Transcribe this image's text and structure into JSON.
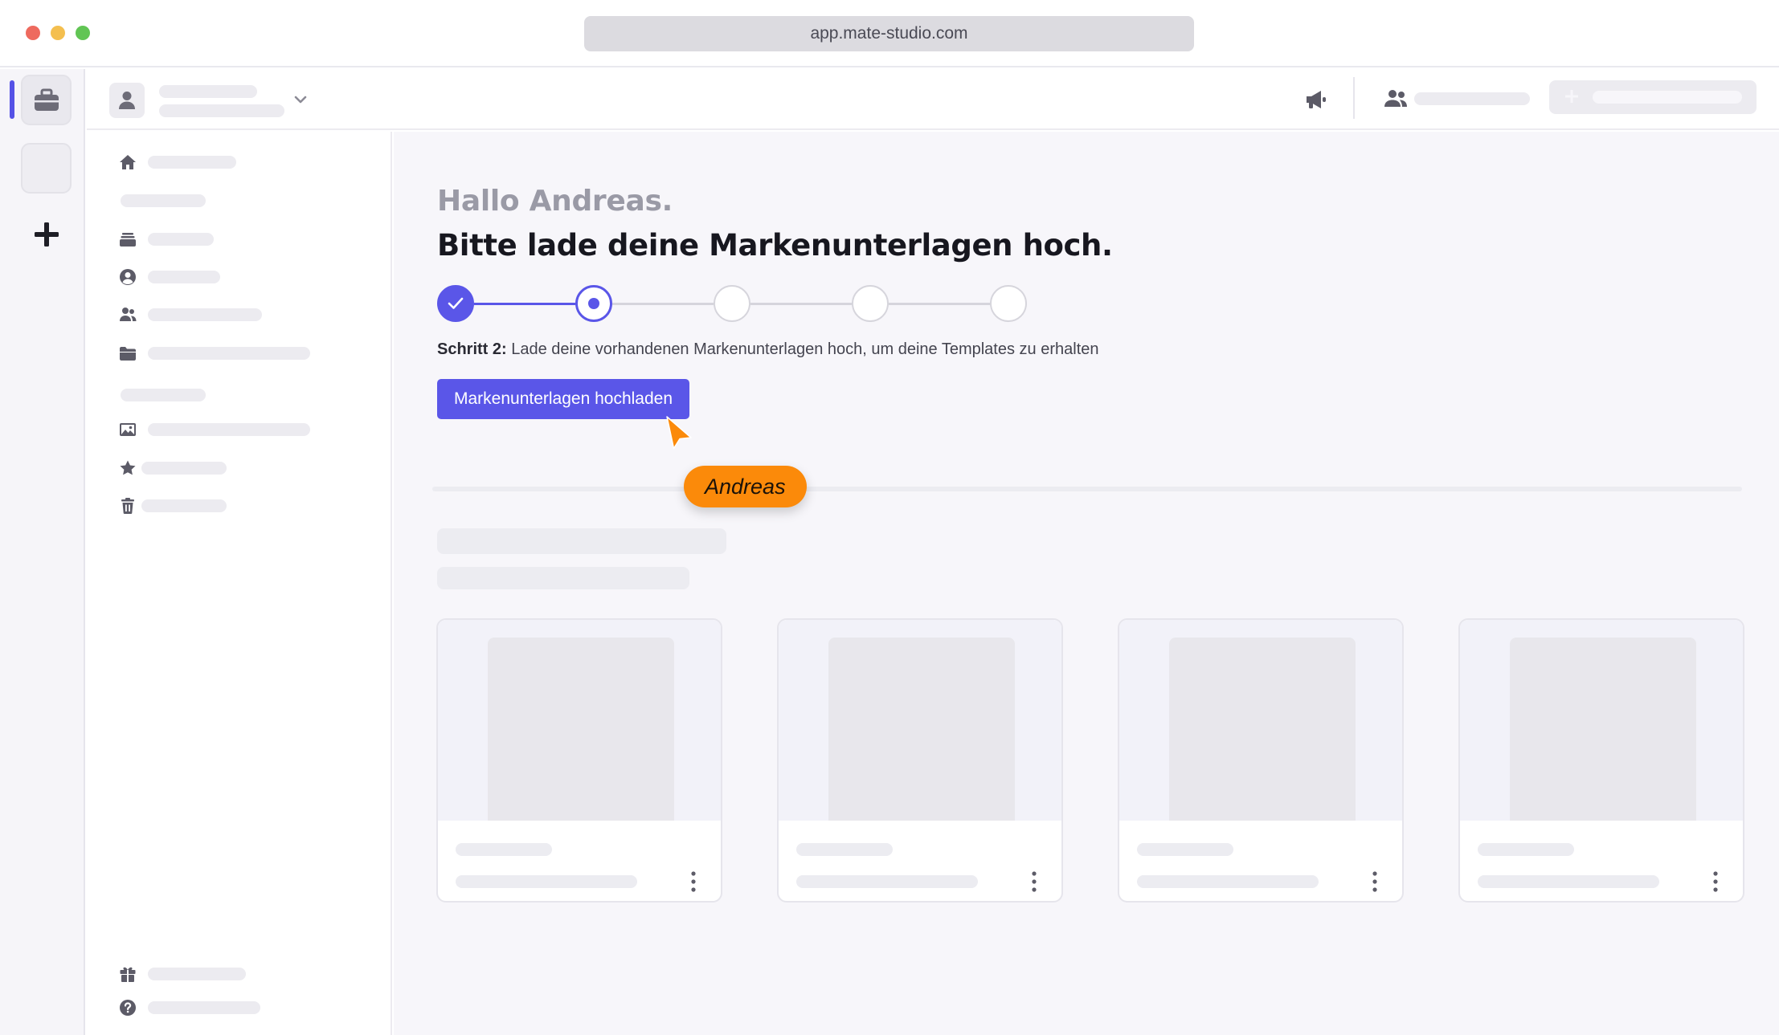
{
  "browser": {
    "url": "app.mate-studio.com"
  },
  "icons": {
    "rail_active": "briefcase-icon",
    "rail_add": "plus-icon",
    "header_profile": "user-icon",
    "header_dropdown": "chevron-down-icon",
    "header_announcements": "megaphone-icon",
    "header_team": "users-icon",
    "header_create": "plus-icon",
    "sidebar": [
      "home-icon",
      "archive-icon",
      "user-circle-icon",
      "users-icon",
      "folder-icon",
      "image-icon",
      "star-icon",
      "trash-icon",
      "gift-icon",
      "help-icon"
    ],
    "card_menu": "kebab-menu-icon",
    "cursor": "pointer-cursor-icon"
  },
  "main": {
    "greeting": "Hallo Andreas.",
    "headline": "Bitte lade deine Markenunterlagen hoch.",
    "stepper": {
      "total_steps": 5,
      "completed_steps": 1,
      "current_step": 2
    },
    "step_label": "Schritt 2:",
    "step_description": "Lade deine vorhandenen Markenunterlagen hoch, um deine Templates zu erhalten",
    "upload_button_label": "Markenunterlagen hochladen",
    "cursor_name": "Andreas"
  },
  "colors": {
    "accent": "#5a56e8",
    "cursor_tag": "#fb8a0a",
    "skeleton": "#ecebf0"
  }
}
